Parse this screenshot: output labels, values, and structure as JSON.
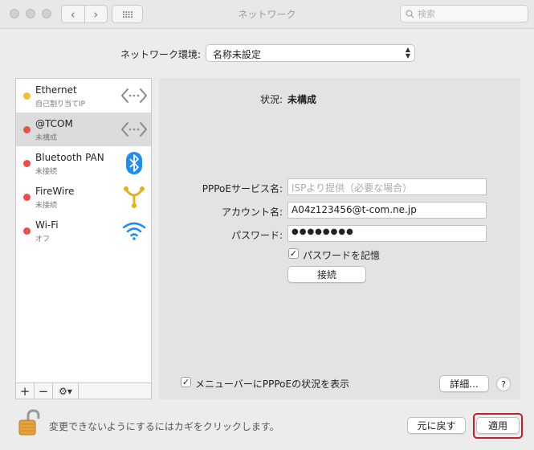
{
  "window": {
    "title": "ネットワーク",
    "search_placeholder": "検索"
  },
  "location": {
    "label": "ネットワーク環境:",
    "value": "名称未設定"
  },
  "services": [
    {
      "name": "Ethernet",
      "status": "自己割り当てIP",
      "dot": "yellow",
      "icon": "ethernet-arrows-icon",
      "selected": false
    },
    {
      "name": "@TCOM",
      "status": "未構成",
      "dot": "red",
      "icon": "ethernet-arrows-icon",
      "selected": true
    },
    {
      "name": "Bluetooth PAN",
      "status": "未接続",
      "dot": "red",
      "icon": "bluetooth-icon",
      "selected": false
    },
    {
      "name": "FireWire",
      "status": "未接続",
      "dot": "red",
      "icon": "firewire-icon",
      "selected": false
    },
    {
      "name": "Wi-Fi",
      "status": "オフ",
      "dot": "red",
      "icon": "wifi-icon",
      "selected": false
    }
  ],
  "list_toolbar": {
    "add": "+",
    "remove": "−"
  },
  "detail": {
    "status_label": "状況:",
    "status_value": "未構成",
    "pppoe_service_label": "PPPoEサービス名:",
    "pppoe_service_placeholder": "ISPより提供（必要な場合）",
    "account_label": "アカウント名:",
    "account_value": "A04z123456@t-com.ne.jp",
    "password_label": "パスワード:",
    "password_value": "●●●●●●●●",
    "remember_password_label": "パスワードを記憶",
    "remember_password_checked": true,
    "connect_button": "接続",
    "menubar_status_label": "メニューバーにPPPoEの状況を表示",
    "menubar_status_checked": true,
    "advanced_button": "詳細...",
    "help_button": "?"
  },
  "footer": {
    "lock_text": "変更できないようにするにはカギをクリックします。",
    "revert_button": "元に戻す",
    "apply_button": "適用"
  },
  "colors": {
    "dot_yellow": "#f4be2f",
    "dot_red": "#ee4e4a",
    "highlight": "#c0202a",
    "bluetooth": "#1f8ef1",
    "accent_blue": "#1f8ef1"
  }
}
